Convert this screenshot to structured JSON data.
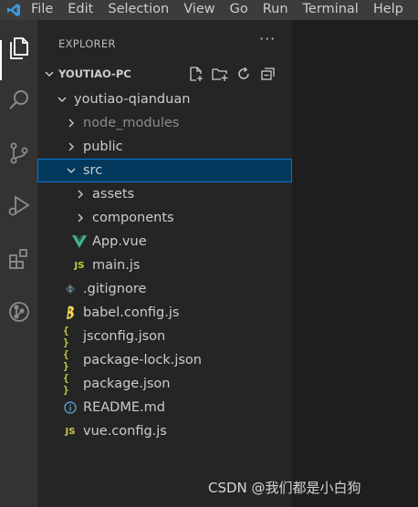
{
  "menu": [
    "File",
    "Edit",
    "Selection",
    "View",
    "Go",
    "Run",
    "Terminal",
    "Help"
  ],
  "explorer": {
    "title": "EXPLORER",
    "more": "···",
    "section_title": "YOUTIAO-PC"
  },
  "tree": [
    {
      "label": "youtiao-qianduan",
      "type": "folder-open",
      "depth": 1
    },
    {
      "label": "node_modules",
      "type": "folder",
      "depth": 2,
      "dim": true
    },
    {
      "label": "public",
      "type": "folder",
      "depth": 2
    },
    {
      "label": "src",
      "type": "folder-open",
      "depth": 2,
      "selected": true
    },
    {
      "label": "assets",
      "type": "folder",
      "depth": 3
    },
    {
      "label": "components",
      "type": "folder",
      "depth": 3
    },
    {
      "label": "App.vue",
      "type": "vue",
      "depth": 3
    },
    {
      "label": "main.js",
      "type": "js",
      "depth": 3
    },
    {
      "label": ".gitignore",
      "type": "git",
      "depth": 2
    },
    {
      "label": "babel.config.js",
      "type": "babel",
      "depth": 2
    },
    {
      "label": "jsconfig.json",
      "type": "json",
      "depth": 2
    },
    {
      "label": "package-lock.json",
      "type": "json",
      "depth": 2
    },
    {
      "label": "package.json",
      "type": "json",
      "depth": 2
    },
    {
      "label": "README.md",
      "type": "info",
      "depth": 2
    },
    {
      "label": "vue.config.js",
      "type": "js",
      "depth": 2
    }
  ],
  "icon_glyphs": {
    "js": "JS",
    "json": "{ }"
  },
  "watermark": "CSDN @我们都是小白狗",
  "colors": {
    "titlebar": "#3c3c3c",
    "activitybar": "#333333",
    "sidebar": "#252526",
    "editor": "#1e1e1e",
    "selection": "#04395e",
    "selection_border": "#0078d4",
    "vue": "#41b883",
    "js": "#cbcb41"
  }
}
